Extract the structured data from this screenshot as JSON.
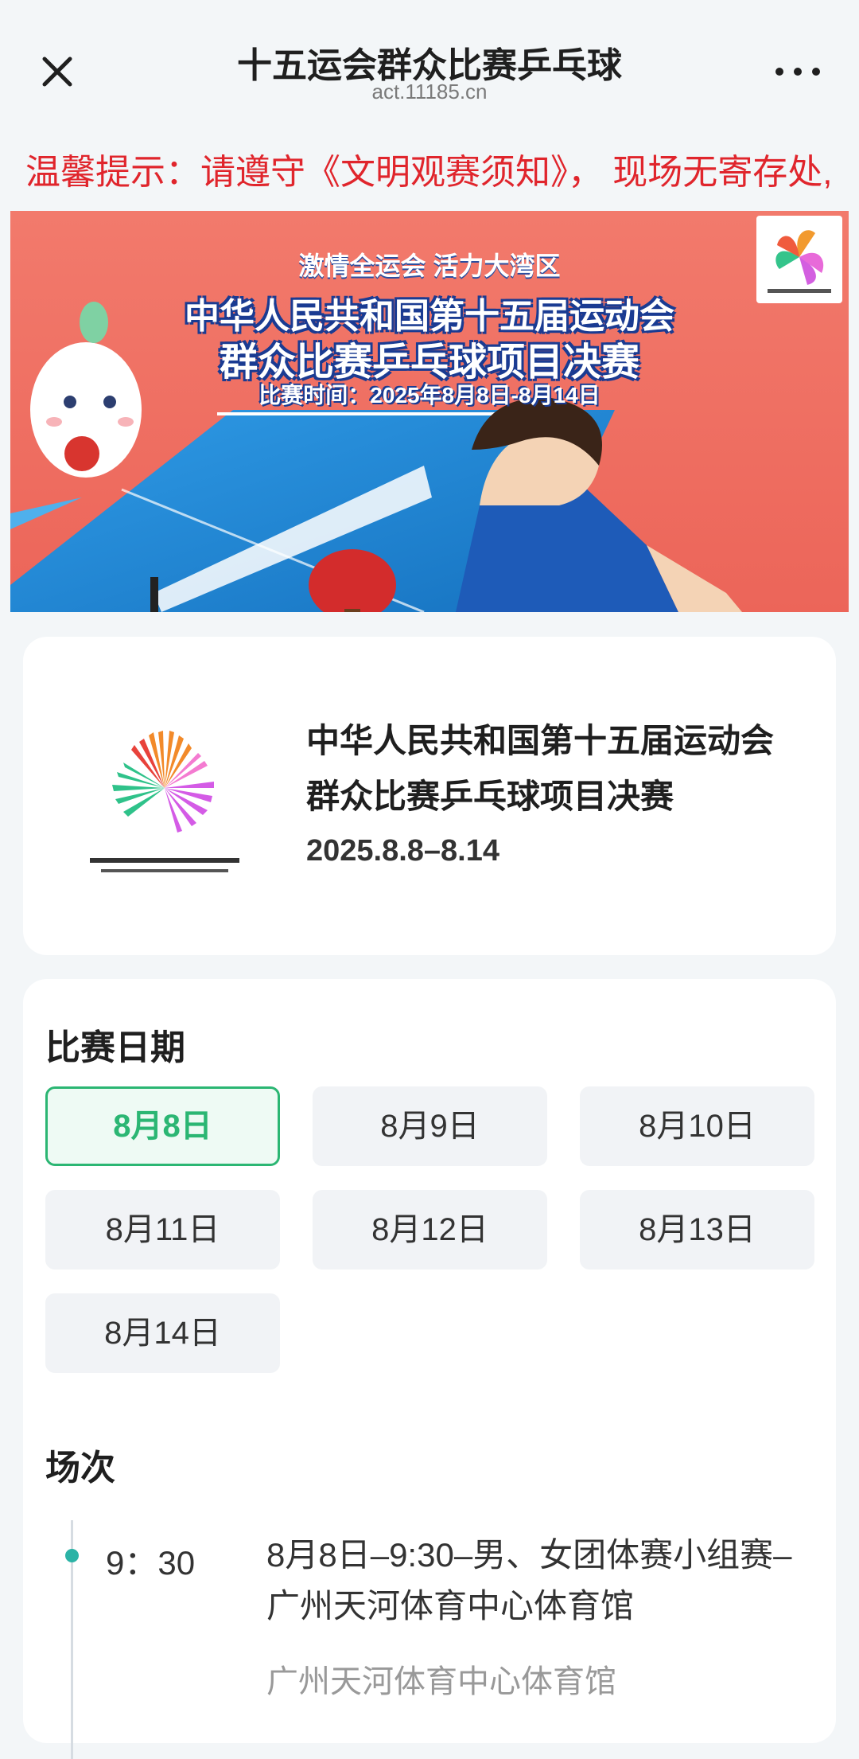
{
  "nav": {
    "title": "十五运会群众比赛乒乓球",
    "url": "act.11185.cn"
  },
  "notice": {
    "text": "温馨提示：请遵守《文明观赛须知》， 现场无寄存处,"
  },
  "banner": {
    "slogan": "激情全运会  活力大湾区",
    "line1": "中华人民共和国第十五届运动会",
    "line2": "群众比赛乒乓球项目决赛",
    "time": "比赛时间：2025年8月8日-8月14日"
  },
  "event": {
    "title_line1": "中华人民共和国第十五届运动会",
    "title_line2": "群众比赛乒乓球项目决赛",
    "dates": "2025.8.8–8.14"
  },
  "schedule": {
    "date_section_title": "比赛日期",
    "dates": [
      "8月8日",
      "8月9日",
      "8月10日",
      "8月11日",
      "8月12日",
      "8月13日",
      "8月14日"
    ],
    "selected_date": "8月8日",
    "session_section_title": "场次",
    "sessions": [
      {
        "time": "9：30",
        "title": "8月8日–9:30–男、女团体赛小组赛–广州天河体育中心体育馆",
        "venue": "广州天河体育中心体育馆"
      }
    ]
  },
  "colors": {
    "accent_green": "#2bb673",
    "notice_red": "#e0252c",
    "banner_bg": "#ef6f64",
    "table_blue": "#1f8bd8"
  }
}
